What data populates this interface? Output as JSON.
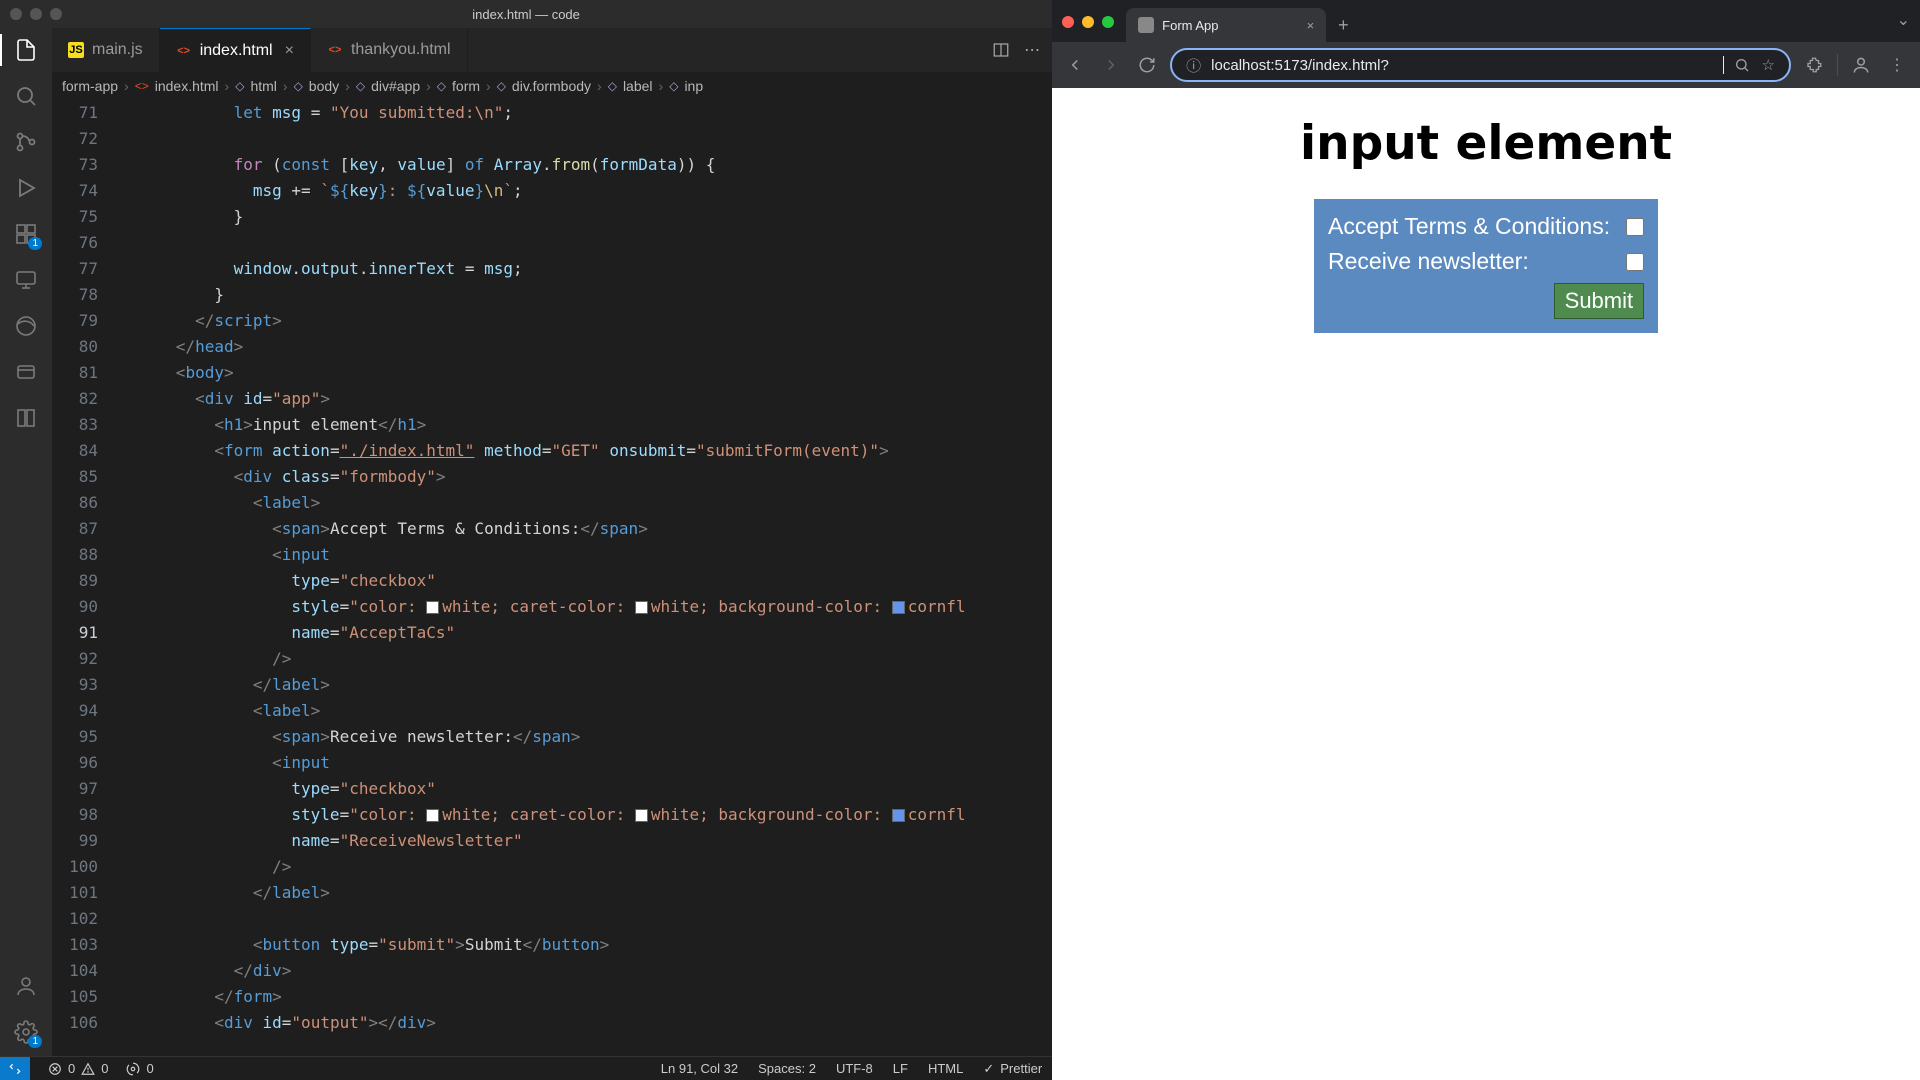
{
  "vscode": {
    "window_title": "index.html — code",
    "tabs": [
      {
        "icon": "js",
        "label": "main.js",
        "active": false,
        "close": false
      },
      {
        "icon": "html",
        "label": "index.html",
        "active": true,
        "close": true
      },
      {
        "icon": "html",
        "label": "thankyou.html",
        "active": false,
        "close": false
      }
    ],
    "breadcrumb": [
      "form-app",
      "index.html",
      "html",
      "body",
      "div#app",
      "form",
      "div.formbody",
      "label",
      "inp"
    ],
    "activity_badge": "1",
    "settings_badge": "1",
    "statusbar": {
      "errors": "0",
      "warnings": "0",
      "ports": "0",
      "cursor": "Ln 91, Col 32",
      "spaces": "Spaces: 2",
      "encoding": "UTF-8",
      "eol": "LF",
      "lang": "HTML",
      "prettier": "Prettier"
    },
    "code": {
      "first_line_no": 71,
      "active_line_no": 91,
      "lines": [
        {
          "n": 71,
          "indent": 6,
          "t": "let-msg"
        },
        {
          "n": 72,
          "indent": 0,
          "t": "blank"
        },
        {
          "n": 73,
          "indent": 6,
          "t": "for-of"
        },
        {
          "n": 74,
          "indent": 7,
          "t": "msg-append"
        },
        {
          "n": 75,
          "indent": 6,
          "t": "brace-close"
        },
        {
          "n": 76,
          "indent": 0,
          "t": "blank"
        },
        {
          "n": 77,
          "indent": 6,
          "t": "output-set"
        },
        {
          "n": 78,
          "indent": 5,
          "t": "brace-close"
        },
        {
          "n": 79,
          "indent": 4,
          "t": "end-script"
        },
        {
          "n": 80,
          "indent": 3,
          "t": "end-head"
        },
        {
          "n": 81,
          "indent": 3,
          "t": "open-body"
        },
        {
          "n": 82,
          "indent": 4,
          "t": "div-app"
        },
        {
          "n": 83,
          "indent": 5,
          "t": "h1"
        },
        {
          "n": 84,
          "indent": 5,
          "t": "form-open"
        },
        {
          "n": 85,
          "indent": 6,
          "t": "div-formbody"
        },
        {
          "n": 86,
          "indent": 7,
          "t": "label-open"
        },
        {
          "n": 87,
          "indent": 8,
          "t": "span-terms"
        },
        {
          "n": 88,
          "indent": 8,
          "t": "input-open"
        },
        {
          "n": 89,
          "indent": 9,
          "t": "type-checkbox"
        },
        {
          "n": 90,
          "indent": 9,
          "t": "style-line"
        },
        {
          "n": 91,
          "indent": 9,
          "t": "name-tacs"
        },
        {
          "n": 92,
          "indent": 8,
          "t": "selfclose"
        },
        {
          "n": 93,
          "indent": 7,
          "t": "label-close"
        },
        {
          "n": 94,
          "indent": 7,
          "t": "label-open"
        },
        {
          "n": 95,
          "indent": 8,
          "t": "span-news"
        },
        {
          "n": 96,
          "indent": 8,
          "t": "input-open"
        },
        {
          "n": 97,
          "indent": 9,
          "t": "type-checkbox"
        },
        {
          "n": 98,
          "indent": 9,
          "t": "style-line"
        },
        {
          "n": 99,
          "indent": 9,
          "t": "name-news"
        },
        {
          "n": 100,
          "indent": 8,
          "t": "selfclose"
        },
        {
          "n": 101,
          "indent": 7,
          "t": "label-close"
        },
        {
          "n": 102,
          "indent": 0,
          "t": "blank"
        },
        {
          "n": 103,
          "indent": 7,
          "t": "button-submit"
        },
        {
          "n": 104,
          "indent": 6,
          "t": "div-close"
        },
        {
          "n": 105,
          "indent": 5,
          "t": "form-close"
        },
        {
          "n": 106,
          "indent": 5,
          "t": "div-output"
        }
      ],
      "strings": {
        "msg_init": "\"You submitted:\\n\"",
        "h1_text": "input element",
        "form_action": "\"./index.html\"",
        "form_method": "\"GET\"",
        "form_onsubmit": "\"submitForm(event)\"",
        "formbody_class": "\"formbody\"",
        "terms_text": "Accept Terms & Conditions:",
        "news_text": "Receive newsletter:",
        "checkbox": "\"checkbox\"",
        "name_tacs": "\"AcceptTaCs\"",
        "name_news": "\"ReceiveNewsletter\"",
        "button_type": "\"submit\"",
        "button_text": "Submit",
        "app_id": "\"app\"",
        "output_id": "\"output\"",
        "color_white": "white",
        "color_cornfl": "cornfl"
      }
    }
  },
  "chrome": {
    "tab_title": "Form App",
    "url": "localhost:5173/index.html?",
    "page": {
      "heading": "input element",
      "row1_label": "Accept Terms & Conditions:",
      "row2_label": "Receive newsletter:",
      "submit": "Submit"
    }
  }
}
